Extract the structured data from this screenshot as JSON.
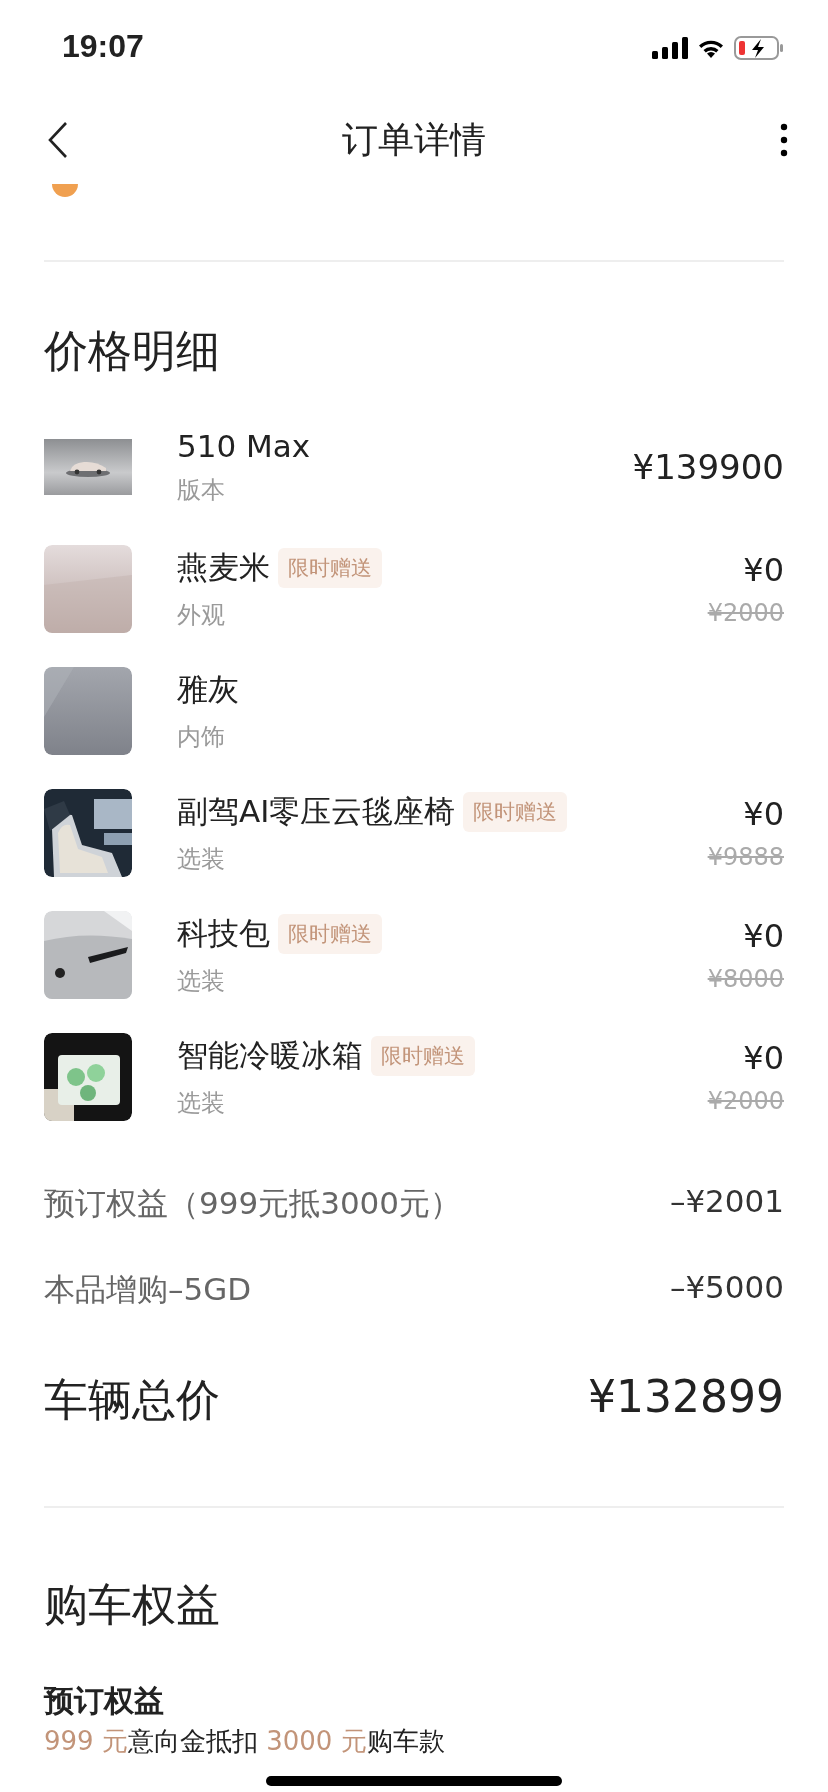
{
  "status_bar": {
    "time": "19:07"
  },
  "header": {
    "title": "订单详情"
  },
  "price_section": {
    "title": "价格明细",
    "items": [
      {
        "name": "510 Max",
        "category": "版本",
        "price": "¥139900"
      },
      {
        "name": "燕麦米",
        "badge": "限时赠送",
        "category": "外观",
        "price": "¥0",
        "original_price": "¥2000"
      },
      {
        "name": "雅灰",
        "category": "内饰"
      },
      {
        "name": "副驾AI零压云毯座椅",
        "badge": "限时赠送",
        "category": "选装",
        "price": "¥0",
        "original_price": "¥9888"
      },
      {
        "name": "科技包",
        "badge": "限时赠送",
        "category": "选装",
        "price": "¥0",
        "original_price": "¥8000"
      },
      {
        "name": "智能冷暖冰箱",
        "badge": "限时赠送",
        "category": "选装",
        "price": "¥0",
        "original_price": "¥2000"
      }
    ],
    "discounts": [
      {
        "label": "预订权益（999元抵3000元）",
        "amount": "–¥2001"
      },
      {
        "label": "本品增购–5GD",
        "amount": "–¥5000"
      }
    ],
    "total": {
      "label": "车辆总价",
      "amount": "¥132899"
    }
  },
  "benefits_section": {
    "title": "购车权益",
    "subtitle": "预订权益",
    "line": [
      {
        "text": "999 元",
        "highlight": true
      },
      {
        "text": "意向金抵扣 ",
        "highlight": false
      },
      {
        "text": "3000 元",
        "highlight": true
      },
      {
        "text": "购车款",
        "highlight": false
      }
    ]
  }
}
